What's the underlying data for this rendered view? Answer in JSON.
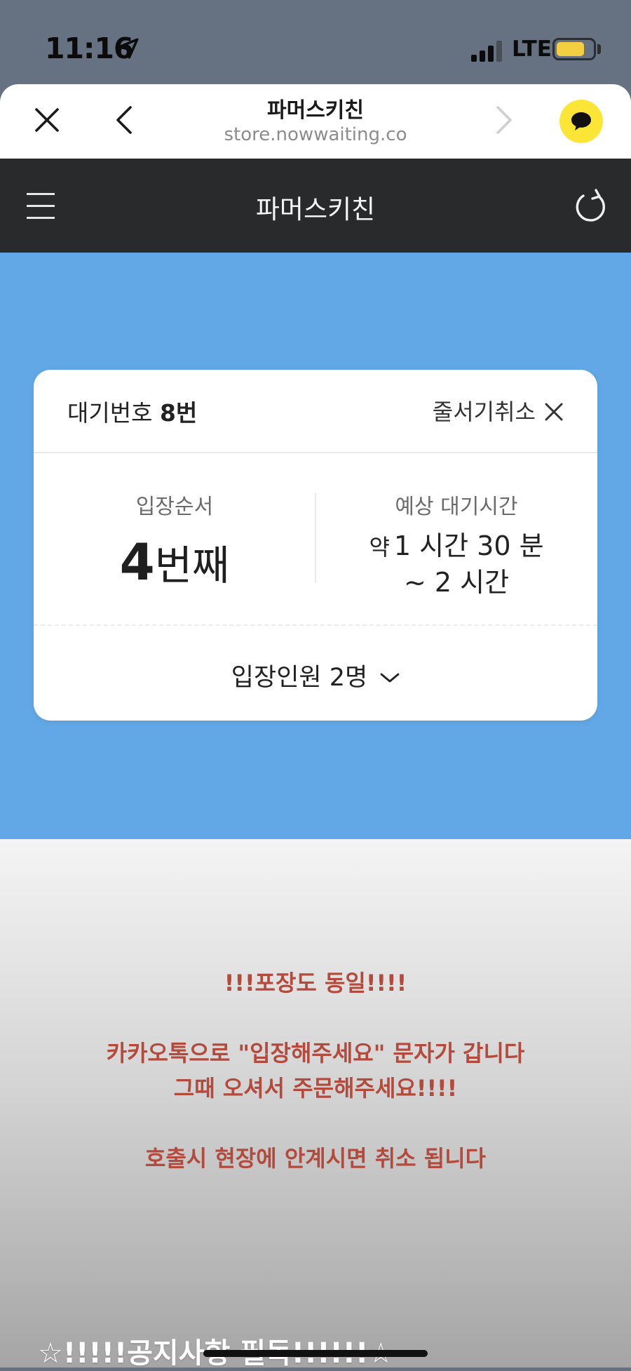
{
  "status_bar": {
    "time": "11:16",
    "network": "LTE",
    "battery_level": 0.78
  },
  "browser": {
    "title": "파머스키친",
    "url": "store.nowwaiting.co"
  },
  "app_header": {
    "title": "파머스키친"
  },
  "card": {
    "wait_label": "대기번호",
    "wait_number": "8번",
    "cancel_label": "줄서기취소",
    "order_label": "입장순서",
    "order_number": "4",
    "order_unit": "번째",
    "time_label": "예상 대기시간",
    "time_prefix": "약",
    "time_line1": "1 시간 30 분",
    "time_line2": "~ 2 시간",
    "party_label": "입장인원 2명"
  },
  "notice": {
    "lines": [
      "!!!포장도 동일!!!!",
      "",
      "카카오톡으로 \"입장해주세요\" 문자가 갑니다",
      "그때 오셔서 주문해주세요!!!!",
      "",
      "호출시 현장에 안계시면 취소 됩니다"
    ],
    "title": "☆!!!!!공지사항 필독!!!!!!☆"
  },
  "colors": {
    "status_bg": "#667281",
    "header_bg": "#292a2c",
    "hero_blue": "#62a8e6",
    "kakao_yellow": "#fbe637",
    "notice_red": "#b34a3c"
  }
}
